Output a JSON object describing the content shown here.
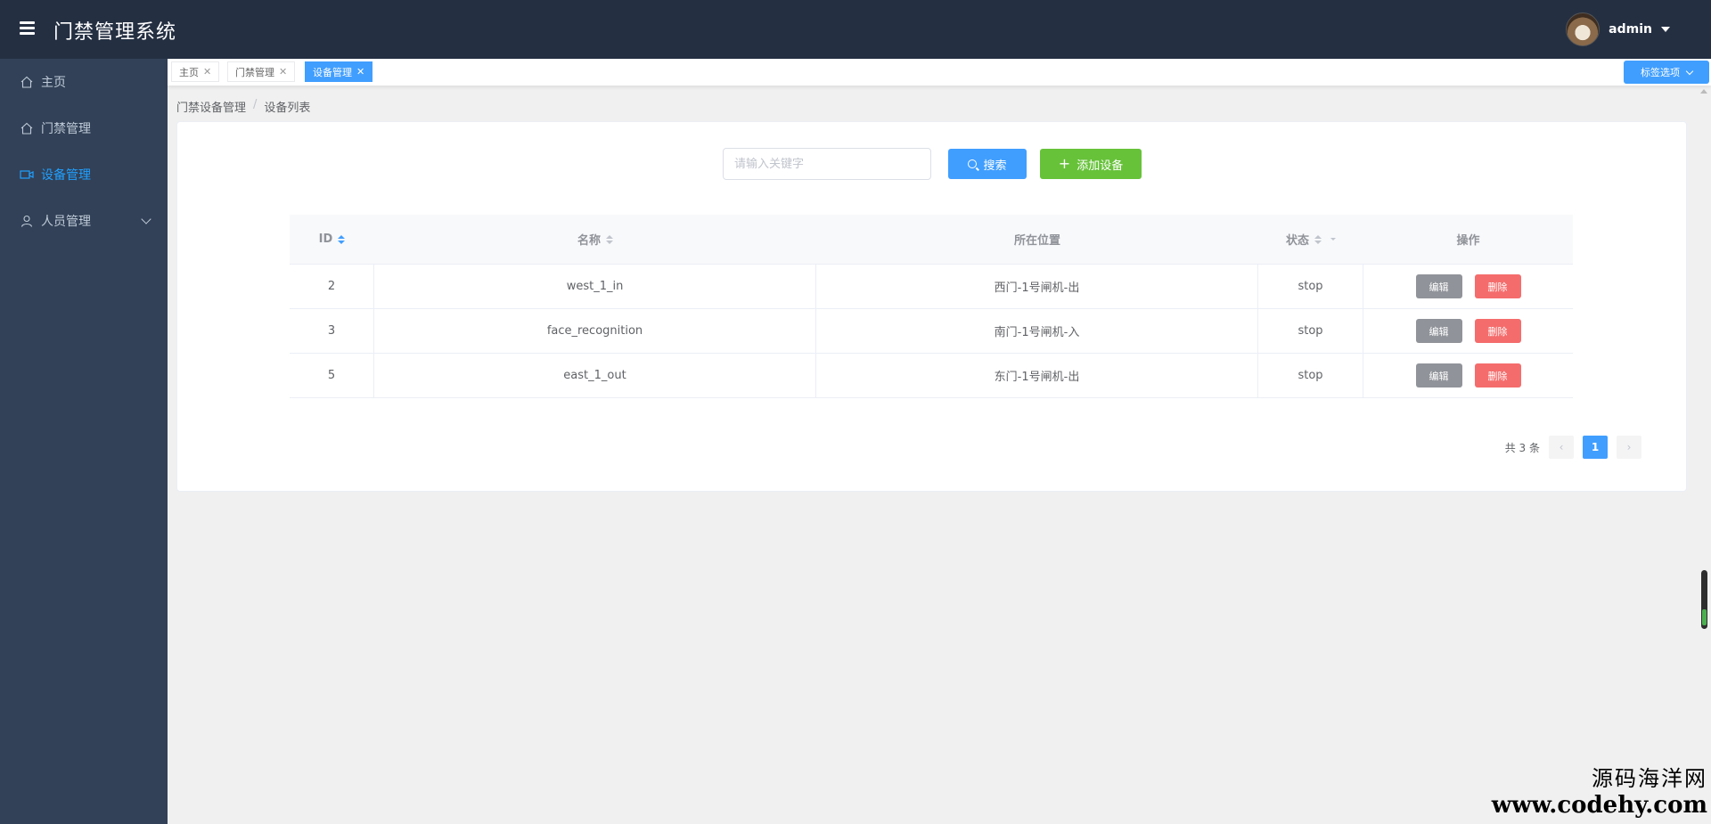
{
  "header": {
    "title": "门禁管理系统",
    "username": "admin"
  },
  "sidebar": {
    "items": [
      {
        "label": "主页",
        "icon": "home-icon",
        "active": false
      },
      {
        "label": "门禁管理",
        "icon": "home-icon",
        "active": false
      },
      {
        "label": "设备管理",
        "icon": "video-camera-icon",
        "active": true
      },
      {
        "label": "人员管理",
        "icon": "user-icon",
        "active": false,
        "expandable": true
      }
    ]
  },
  "tags": {
    "items": [
      {
        "label": "主页",
        "active": false
      },
      {
        "label": "门禁管理",
        "active": false
      },
      {
        "label": "设备管理",
        "active": true
      }
    ],
    "options_label": "标签选项"
  },
  "breadcrumb": {
    "parent": "门禁设备管理",
    "current": "设备列表",
    "separator": "/"
  },
  "search": {
    "placeholder": "请输入关键字",
    "value": "",
    "search_label": "搜索",
    "add_label": "添加设备"
  },
  "table": {
    "headers": {
      "id": "ID",
      "name": "名称",
      "location": "所在位置",
      "status": "状态",
      "ops": "操作"
    },
    "rows": [
      {
        "id": "2",
        "name": "west_1_in",
        "location": "西门-1号闸机-出",
        "status": "stop"
      },
      {
        "id": "3",
        "name": "face_recognition",
        "location": "南门-1号闸机-入",
        "status": "stop"
      },
      {
        "id": "5",
        "name": "east_1_out",
        "location": "东门-1号闸机-出",
        "status": "stop"
      }
    ],
    "edit_label": "编辑",
    "delete_label": "删除"
  },
  "pagination": {
    "total_label": "共 3 条",
    "current_page": "1",
    "prev": "‹",
    "next": "›"
  },
  "watermark": {
    "line1": "源码海洋网",
    "line2": "www.codehy.com"
  },
  "colors": {
    "primary": "#409eff",
    "success": "#67c23a",
    "danger": "#f56c6c",
    "header_bg": "#242f42",
    "sidebar_bg": "#324157"
  }
}
